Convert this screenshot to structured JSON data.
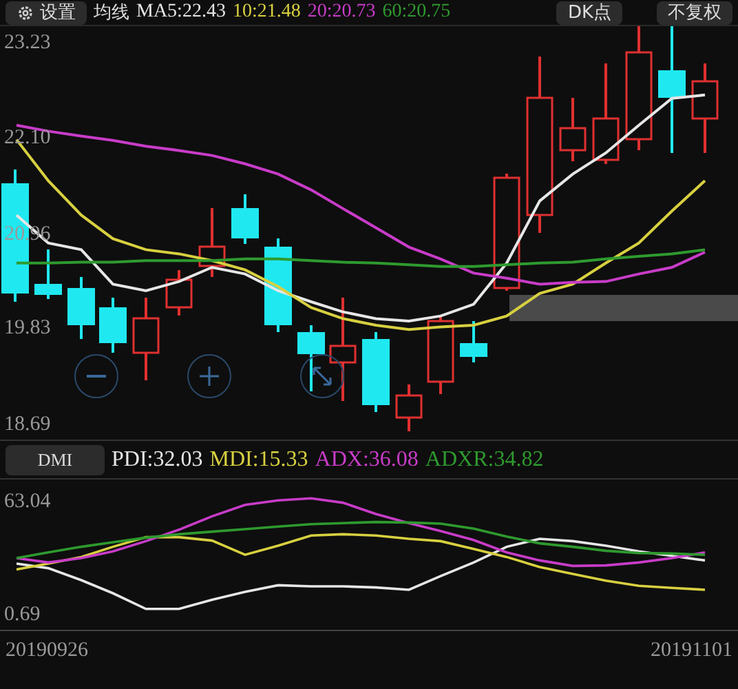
{
  "toolbar": {
    "settings_button": "设置",
    "ma_label": "均线",
    "dk_button": "DK点",
    "adjust_button": "不复权"
  },
  "price_chart": {
    "chart_data": {
      "type": "line",
      "ylim": [
        18.51,
        23.74
      ],
      "yticks": [
        {
          "value": 23.23,
          "label": "23.23"
        },
        {
          "value": 22.1,
          "label": "22.10"
        },
        {
          "value": 20.96,
          "label": "20.96"
        },
        {
          "value": 19.83,
          "label": "19.83"
        },
        {
          "value": 18.69,
          "label": "18.69"
        }
      ],
      "series": [
        {
          "name": "MA5:22.43",
          "color": "#e6e6e6",
          "values": [
            21.18,
            20.85,
            20.77,
            20.36,
            20.28,
            20.39,
            20.56,
            20.48,
            20.28,
            20.15,
            20.03,
            19.95,
            19.92,
            19.98,
            20.12,
            20.61,
            21.35,
            21.67,
            21.92,
            22.25,
            22.57,
            22.61
          ]
        },
        {
          "name": "10:21.48",
          "color": "#d8d040",
          "values": [
            22.08,
            21.59,
            21.18,
            20.9,
            20.77,
            20.72,
            20.64,
            20.53,
            20.33,
            20.08,
            19.95,
            19.87,
            19.82,
            19.85,
            19.87,
            19.98,
            20.25,
            20.36,
            20.61,
            20.85,
            21.23,
            21.59
          ]
        },
        {
          "name": "20:20.73",
          "color": "#c83cc8",
          "values": [
            22.25,
            22.18,
            22.12,
            22.07,
            22.0,
            21.95,
            21.89,
            21.79,
            21.67,
            21.48,
            21.26,
            21.03,
            20.8,
            20.66,
            20.49,
            20.43,
            20.36,
            20.38,
            20.39,
            20.48,
            20.56,
            20.74
          ]
        },
        {
          "name": "60:20.75",
          "color": "#2e9a2e",
          "values": [
            20.61,
            20.61,
            20.62,
            20.62,
            20.64,
            20.64,
            20.64,
            20.66,
            20.66,
            20.64,
            20.62,
            20.61,
            20.59,
            20.57,
            20.57,
            20.59,
            20.61,
            20.62,
            20.66,
            20.69,
            20.72,
            20.77
          ]
        }
      ]
    }
  },
  "indicator": {
    "button": "DMI"
  },
  "indicator_chart": {
    "chart_data": {
      "type": "line",
      "ylim": [
        -7.68,
        75.21
      ],
      "yticks": [
        {
          "value": 63.04,
          "label": "63.04"
        },
        {
          "value": 0.69,
          "label": "0.69"
        }
      ],
      "series": [
        {
          "name": "PDI:32.03",
          "color": "#e6e6e6",
          "values": [
            28.8,
            26.3,
            19.7,
            12.5,
            3.8,
            3.8,
            8.8,
            13.2,
            16.9,
            16.3,
            16.3,
            15.7,
            14.4,
            21.9,
            29.4,
            38.1,
            42.5,
            41.2,
            38.7,
            35.6,
            33.1,
            30.6
          ]
        },
        {
          "name": "MDI:15.33",
          "color": "#d8d040",
          "values": [
            25.6,
            28.8,
            32.5,
            38.1,
            43.4,
            43.4,
            41.5,
            33.7,
            38.7,
            44.3,
            45.0,
            44.3,
            42.5,
            41.2,
            36.9,
            32.5,
            26.9,
            23.1,
            19.4,
            16.6,
            15.4,
            14.4
          ]
        },
        {
          "name": "ADX:36.08",
          "color": "#c83cc8",
          "values": [
            31.9,
            29.4,
            31.9,
            35.6,
            41.2,
            47.5,
            54.9,
            61.2,
            63.7,
            64.9,
            62.4,
            56.2,
            51.2,
            46.8,
            41.8,
            35.0,
            30.6,
            27.5,
            27.8,
            29.4,
            31.9,
            35.0
          ]
        },
        {
          "name": "ADXR:34.82",
          "color": "#2e9a2e",
          "values": [
            31.9,
            35.0,
            38.1,
            40.6,
            43.1,
            45.0,
            46.5,
            47.8,
            49.3,
            50.6,
            51.2,
            51.8,
            51.5,
            50.9,
            48.1,
            43.7,
            40.0,
            38.1,
            35.9,
            34.7,
            34.4,
            33.7
          ]
        }
      ]
    }
  },
  "dates": [
    "20190926",
    "20191101"
  ]
}
